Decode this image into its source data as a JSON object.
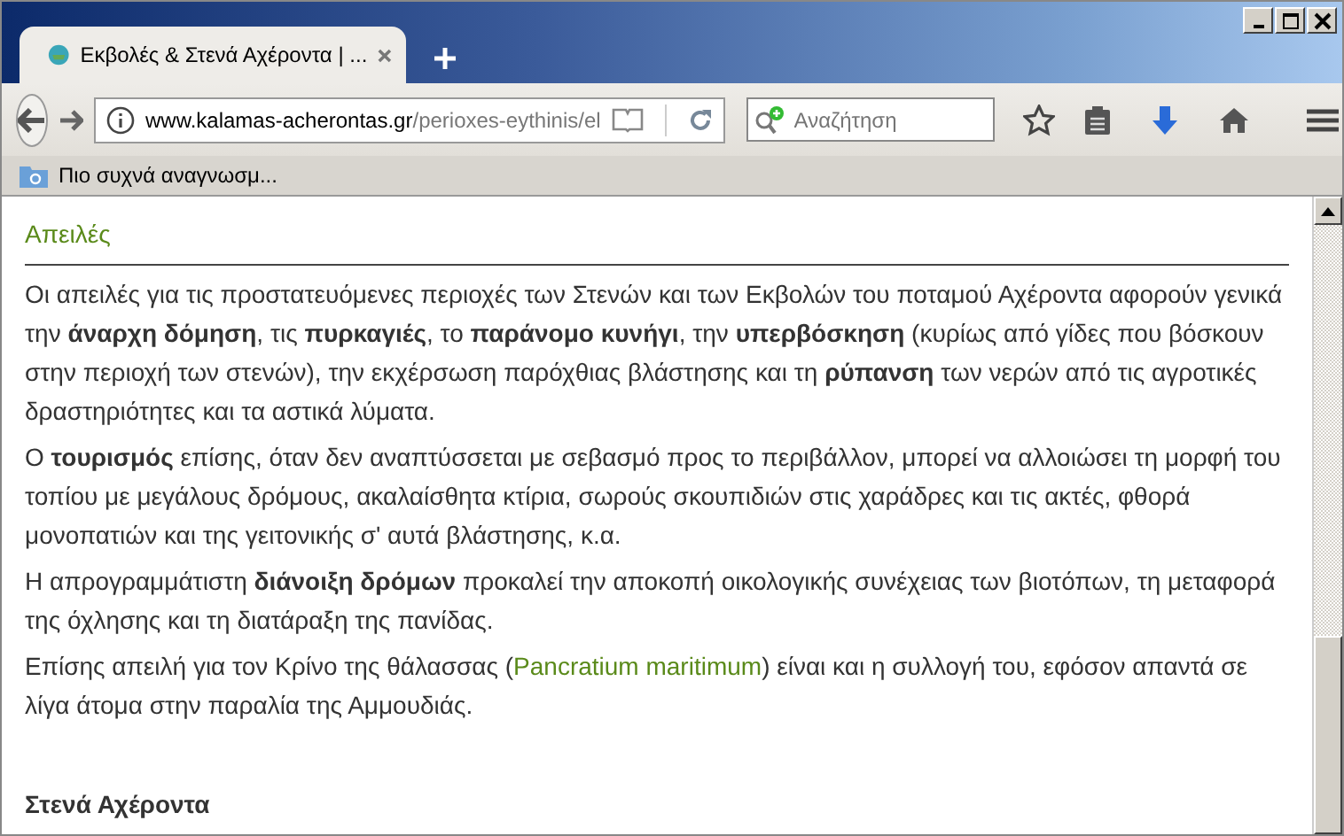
{
  "tabs": [
    {
      "title": "Εκβολές & Στενά Αχέροντα | ...",
      "selected": true
    }
  ],
  "address_bar": {
    "host": "www.kalamas-acherontas.gr",
    "path": "/perioxes-eythinis/el"
  },
  "search": {
    "placeholder": "Αναζήτηση"
  },
  "bookmarks": [
    {
      "label": "Πιο συχνά αναγνωσμ..."
    }
  ],
  "page": {
    "heading": "Απειλές",
    "paragraphs": [
      {
        "text": "Οι απειλές για τις προστατευόμενες περιοχές των Στενών και των Εκβολών του ποταμού Αχέροντα αφορούν γενικά την **άναρχη δόμηση**, τις **πυρκαγιές**, το **παράνομο κυνήγι**, την **υπερβόσκηση** (κυρίως από γίδες που βόσκουν στην περιοχή των στενών), την εκχέρσωση παρόχθιας βλάστησης και τη **ρύπανση** των νερών από τις αγροτικές δραστηριότητες και τα αστικά λύματα."
      },
      {
        "text": "Ο **τουρισμός** επίσης, όταν δεν αναπτύσσεται με σεβασμό προς το περιβάλλον, μπορεί να αλλοιώσει τη μορφή του τοπίου με μεγάλους δρόμους, ακαλαίσθητα κτίρια, σωρούς σκουπιδιών στις χαράδρες και τις ακτές, φθορά μονοπατιών και της γειτονικής σ' αυτά βλάστησης, κ.α."
      },
      {
        "text": "Η απρογραμμάτιστη **διάνοιξη δρόμων** προκαλεί την αποκοπή οικολογικής συνέχειας των βιοτόπων, τη μεταφορά της όχλησης και τη διατάραξη της πανίδας."
      },
      {
        "text": "Επίσης απειλή για τον Κρίνο της θάλασσας (",
        "link": "Pancratium maritimum",
        "after": ") είναι και η συλλογή του, εφόσον απαντά σε λίγα άτομα στην παραλία της Αμμουδιάς."
      }
    ],
    "subheading": "Στενά Αχέροντα"
  }
}
